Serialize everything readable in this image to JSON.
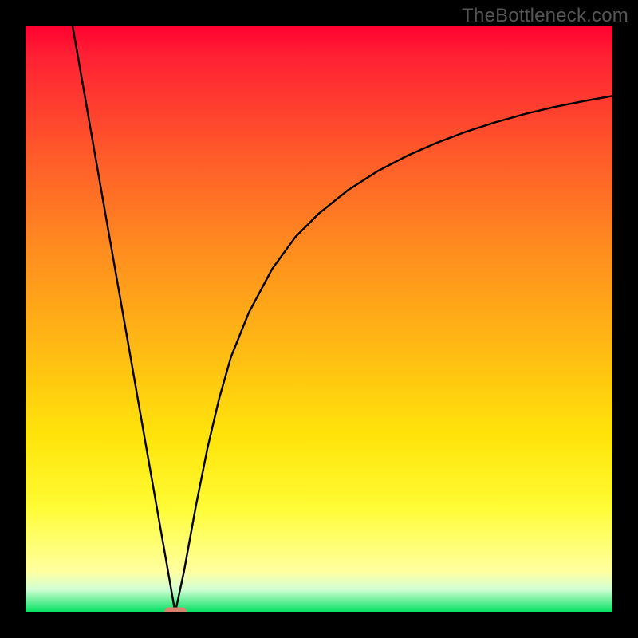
{
  "watermark": "TheBottleneck.com",
  "chart_data": {
    "type": "line",
    "title": "",
    "xlabel": "",
    "ylabel": "",
    "xlim": [
      0,
      100
    ],
    "ylim": [
      0,
      100
    ],
    "grid": false,
    "legend": false,
    "series": [
      {
        "name": "curve",
        "color": "#000000",
        "x": [
          8,
          10,
          12,
          14,
          16,
          18,
          20,
          22,
          24,
          25.5,
          27,
          29,
          31,
          33,
          35,
          38,
          42,
          46,
          50,
          55,
          60,
          65,
          70,
          75,
          80,
          85,
          90,
          95,
          100
        ],
        "y": [
          100,
          88.6,
          77.1,
          65.7,
          54.3,
          42.9,
          31.4,
          20.0,
          8.6,
          0,
          7,
          18,
          28,
          36.5,
          43.5,
          51,
          58.5,
          64,
          68,
          72,
          75.2,
          77.8,
          80,
          81.9,
          83.5,
          84.9,
          86.1,
          87.1,
          88
        ]
      }
    ],
    "marker": {
      "x": 25.5,
      "y": 0,
      "color": "#d9826f"
    }
  }
}
